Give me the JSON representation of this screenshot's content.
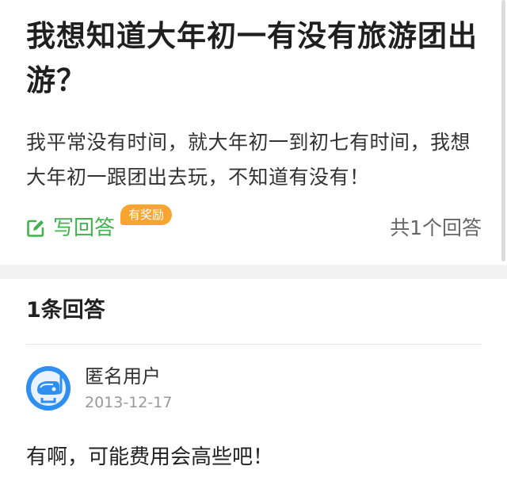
{
  "question": {
    "title": "我想知道大年初一有没有旅游团出游？",
    "description": "我平常没有时间，就大年初一到初七有时间，我想大年初一跟团出去玩，不知道有没有！",
    "answer_button_label": "写回答",
    "reward_badge": "有奖励",
    "answer_count": "共1个回答"
  },
  "answers": {
    "header": "1条回答",
    "items": [
      {
        "user_name": "匿名用户",
        "date": "2013-12-17",
        "text": "有啊，可能费用会高些吧！"
      }
    ]
  },
  "colors": {
    "accent_green": "#3fb44a",
    "badge_orange": "#f7a531",
    "avatar_blue": "#2e8ff0"
  },
  "icons": {
    "answer_button": "edit-icon",
    "avatar": "anonymous-avatar-icon"
  }
}
